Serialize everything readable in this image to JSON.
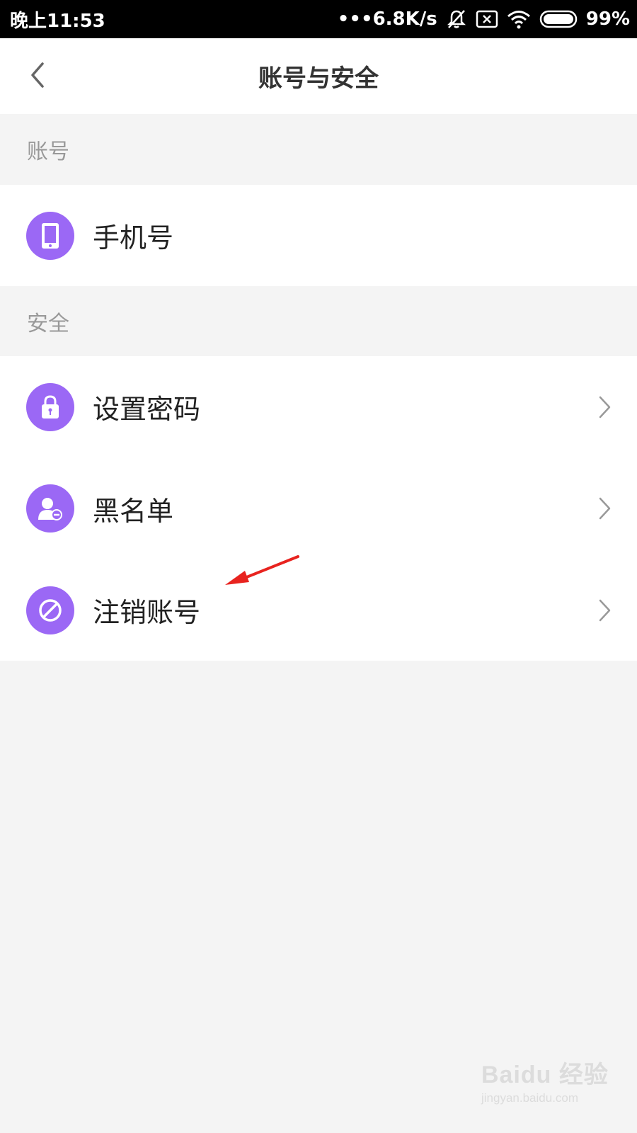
{
  "status_bar": {
    "time": "晚上11:53",
    "network_speed": "•••6.8K/s",
    "battery": "99%",
    "icons": [
      "bell-off-icon",
      "sim-x-icon",
      "wifi-icon",
      "battery-icon"
    ]
  },
  "nav": {
    "title": "账号与安全",
    "back_icon": "chevron-left-icon"
  },
  "sections": {
    "account": {
      "header": "账号",
      "items": [
        {
          "label": "手机号",
          "icon": "phone-icon",
          "has_chevron": false
        }
      ]
    },
    "security": {
      "header": "安全",
      "items": [
        {
          "label": "设置密码",
          "icon": "lock-icon",
          "has_chevron": true
        },
        {
          "label": "黑名单",
          "icon": "user-block-icon",
          "has_chevron": true
        },
        {
          "label": "注销账号",
          "icon": "ban-icon",
          "has_chevron": true
        }
      ]
    }
  },
  "annotation": {
    "arrow_color": "#e8231f"
  },
  "watermark": {
    "logo": "Baidu 经验",
    "url": "jingyan.baidu.com"
  },
  "colors": {
    "accent": "#9b68f5",
    "background": "#f4f4f4",
    "text_primary": "#222222",
    "text_secondary": "#999999"
  }
}
